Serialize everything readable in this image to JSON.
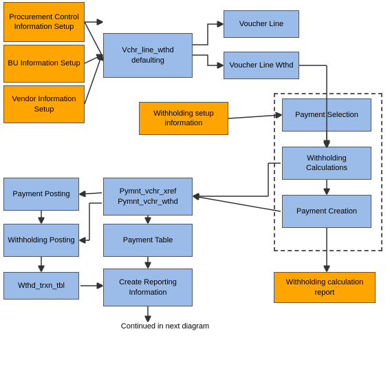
{
  "boxes": {
    "procurement": {
      "label": "Procurement Control Information Setup"
    },
    "bu_info": {
      "label": "BU Information Setup"
    },
    "vendor_info": {
      "label": "Vendor Information Setup"
    },
    "vchr_line": {
      "label": "Vchr_line_wthd defaulting"
    },
    "voucher_line": {
      "label": "Voucher Line"
    },
    "voucher_line_wthd": {
      "label": "Voucher Line Wthd"
    },
    "withholding_setup": {
      "label": "Withholding setup information"
    },
    "payment_selection": {
      "label": "Payment Selection"
    },
    "withholding_calc": {
      "label": "Withholding Calculations"
    },
    "payment_creation": {
      "label": "Payment Creation"
    },
    "payment_posting": {
      "label": "Payment Posting"
    },
    "pymnt_vchr": {
      "label": "Pymnt_vchr_xref Pymnt_vchr_wthd"
    },
    "withholding_posting": {
      "label": "Withholding Posting"
    },
    "payment_table": {
      "label": "Payment Table"
    },
    "wthd_trxn": {
      "label": "Wthd_trxn_tbl"
    },
    "create_reporting": {
      "label": "Create Reporting Information"
    },
    "withholding_report": {
      "label": "Withholding calculation report"
    },
    "continued": {
      "label": "Continued in next diagram"
    }
  }
}
